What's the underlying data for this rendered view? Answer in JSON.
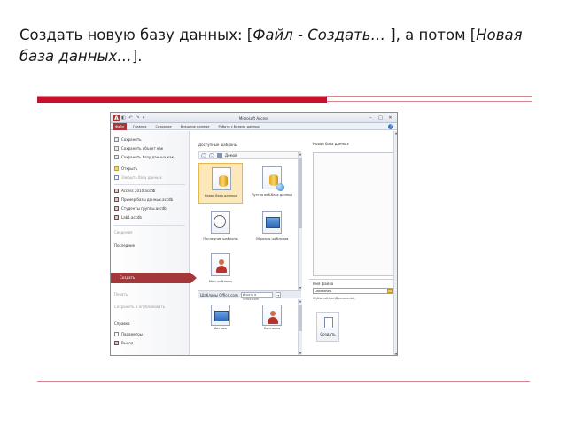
{
  "slide": {
    "title_part1": "Создать новую базу данных: [",
    "title_italic1": "Файл - Создать…",
    "title_part2": " ], а потом [",
    "title_italic2": "Новая база данных…",
    "title_part3": "]."
  },
  "window": {
    "app_icon": "A",
    "qat": "◧ ↶ ↷ ▾",
    "title": "Microsoft Access",
    "minimize": "–",
    "maximize": "□",
    "close": "✕",
    "help": "?",
    "ribbon_tabs": [
      "Файл",
      "Главная",
      "Создание",
      "Внешние данные",
      "Работа с базами данных"
    ]
  },
  "menu": {
    "items": [
      "Сохранить",
      "Сохранить объект как",
      "Сохранить базу данных как",
      "Открыть",
      "Закрыть базу данных"
    ],
    "recent": [
      "Access 2010.accdb",
      "Пример базы данных.accdb",
      "Студенты группы.accdb",
      "Lab1.accdb"
    ],
    "info": "Сведения",
    "recent_title": "Последние",
    "create": "Создать",
    "print": "Печать",
    "save_publish": "Сохранить и опубликовать",
    "help": "Справка",
    "options": "Параметры",
    "exit": "Выход"
  },
  "templates": {
    "available_title": "Доступные шаблоны",
    "nav_home": "Домой",
    "tiles": [
      "Новая база данных",
      "Пустая веб-база данных",
      "Последние шаблоны",
      "Образцы шаблонов",
      "Мои шаблоны"
    ],
    "office_title": "Шаблоны Office.com",
    "search_placeholder": "Искать в Office.com",
    "go": "→",
    "office_tiles": [
      "Активы",
      "Контакты"
    ]
  },
  "right_pane": {
    "title": "Новая база данных",
    "filename_label": "Имя файла",
    "filename_value": "Database1",
    "path": "C:\\Users\\User\\Documents\\",
    "create_label": "Создать"
  },
  "colors": {
    "accent": "#a4373a",
    "slide_bar": "#c8102e",
    "selected_tile": "#fce8b8"
  }
}
